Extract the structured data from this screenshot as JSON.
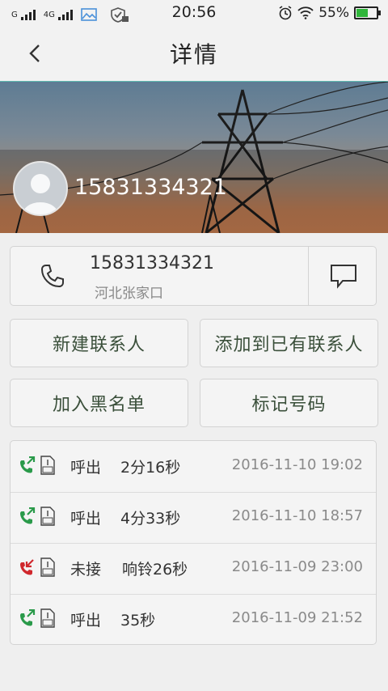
{
  "status_bar": {
    "carrier1": "G",
    "carrier2": "4G",
    "time": "20:56",
    "battery_text": "55%",
    "icons": [
      "signal-icon",
      "signal-4g-icon",
      "gallery-icon",
      "shield-icon",
      "alarm-icon",
      "wifi-icon",
      "battery-icon"
    ]
  },
  "header": {
    "title": "详情",
    "back_icon": "chevron-left-icon"
  },
  "banner": {
    "number": "15831334321",
    "avatar_icon": "contact-avatar-icon"
  },
  "number_card": {
    "number": "15831334321",
    "location": "河北张家口",
    "phone_icon": "phone-icon",
    "sms_icon": "message-icon"
  },
  "actions": {
    "new_contact": "新建联系人",
    "add_existing": "添加到已有联系人",
    "blacklist": "加入黑名单",
    "mark_number": "标记号码"
  },
  "call_log": [
    {
      "type": "呼出",
      "duration": "2分16秒",
      "datetime": "2016-11-10 19:02",
      "status": "outgoing",
      "color": "#2a9a4a"
    },
    {
      "type": "呼出",
      "duration": "4分33秒",
      "datetime": "2016-11-10 18:57",
      "status": "outgoing",
      "color": "#2a9a4a"
    },
    {
      "type": "未接",
      "duration": "响铃26秒",
      "datetime": "2016-11-09 23:00",
      "status": "missed",
      "color": "#d0282d"
    },
    {
      "type": "呼出",
      "duration": "35秒",
      "datetime": "2016-11-09 21:52",
      "status": "outgoing",
      "color": "#2a9a4a"
    }
  ],
  "colors": {
    "accent": "#5fb9b0",
    "outgoing": "#2a9a4a",
    "missed": "#d0282d",
    "battery": "#2fb53a"
  }
}
